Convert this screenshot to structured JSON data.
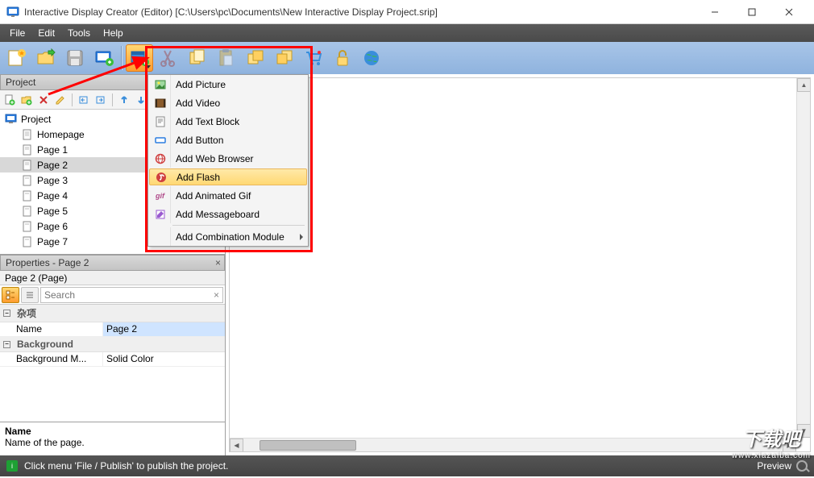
{
  "window": {
    "title": "Interactive Display Creator (Editor) [C:\\Users\\pc\\Documents\\New Interactive Display Project.srip]"
  },
  "menubar": {
    "items": [
      "File",
      "Edit",
      "Tools",
      "Help"
    ]
  },
  "project_panel": {
    "title": "Project",
    "root": "Project",
    "pages": [
      "Homepage",
      "Page 1",
      "Page 2",
      "Page 3",
      "Page 4",
      "Page 5",
      "Page 6",
      "Page 7"
    ],
    "selected": "Page 2"
  },
  "properties_panel": {
    "title": "Properties - Page 2",
    "subtitle": "Page 2 (Page)",
    "search_placeholder": "Search",
    "cat1": "杂项",
    "name_key": "Name",
    "name_val": "Page 2",
    "cat2": "Background",
    "bg_key": "Background M...",
    "bg_val": "Solid Color",
    "desc_title": "Name",
    "desc_text": "Name of the page."
  },
  "dropdown": {
    "items": [
      {
        "label": "Add Picture",
        "icon": "picture"
      },
      {
        "label": "Add Video",
        "icon": "video"
      },
      {
        "label": "Add Text Block",
        "icon": "text"
      },
      {
        "label": "Add Button",
        "icon": "button"
      },
      {
        "label": "Add Web Browser",
        "icon": "globe"
      },
      {
        "label": "Add Flash",
        "icon": "flash",
        "hover": true
      },
      {
        "label": "Add Animated Gif",
        "icon": "gif"
      },
      {
        "label": "Add Messageboard",
        "icon": "msg"
      }
    ],
    "sep_after": 7,
    "submenu": {
      "label": "Add Combination Module"
    }
  },
  "statusbar": {
    "text": "Click menu 'File / Publish' to publish the project.",
    "preview": "Preview"
  },
  "watermark": {
    "big": "下载吧",
    "small": "www.xiazaiba.com"
  }
}
